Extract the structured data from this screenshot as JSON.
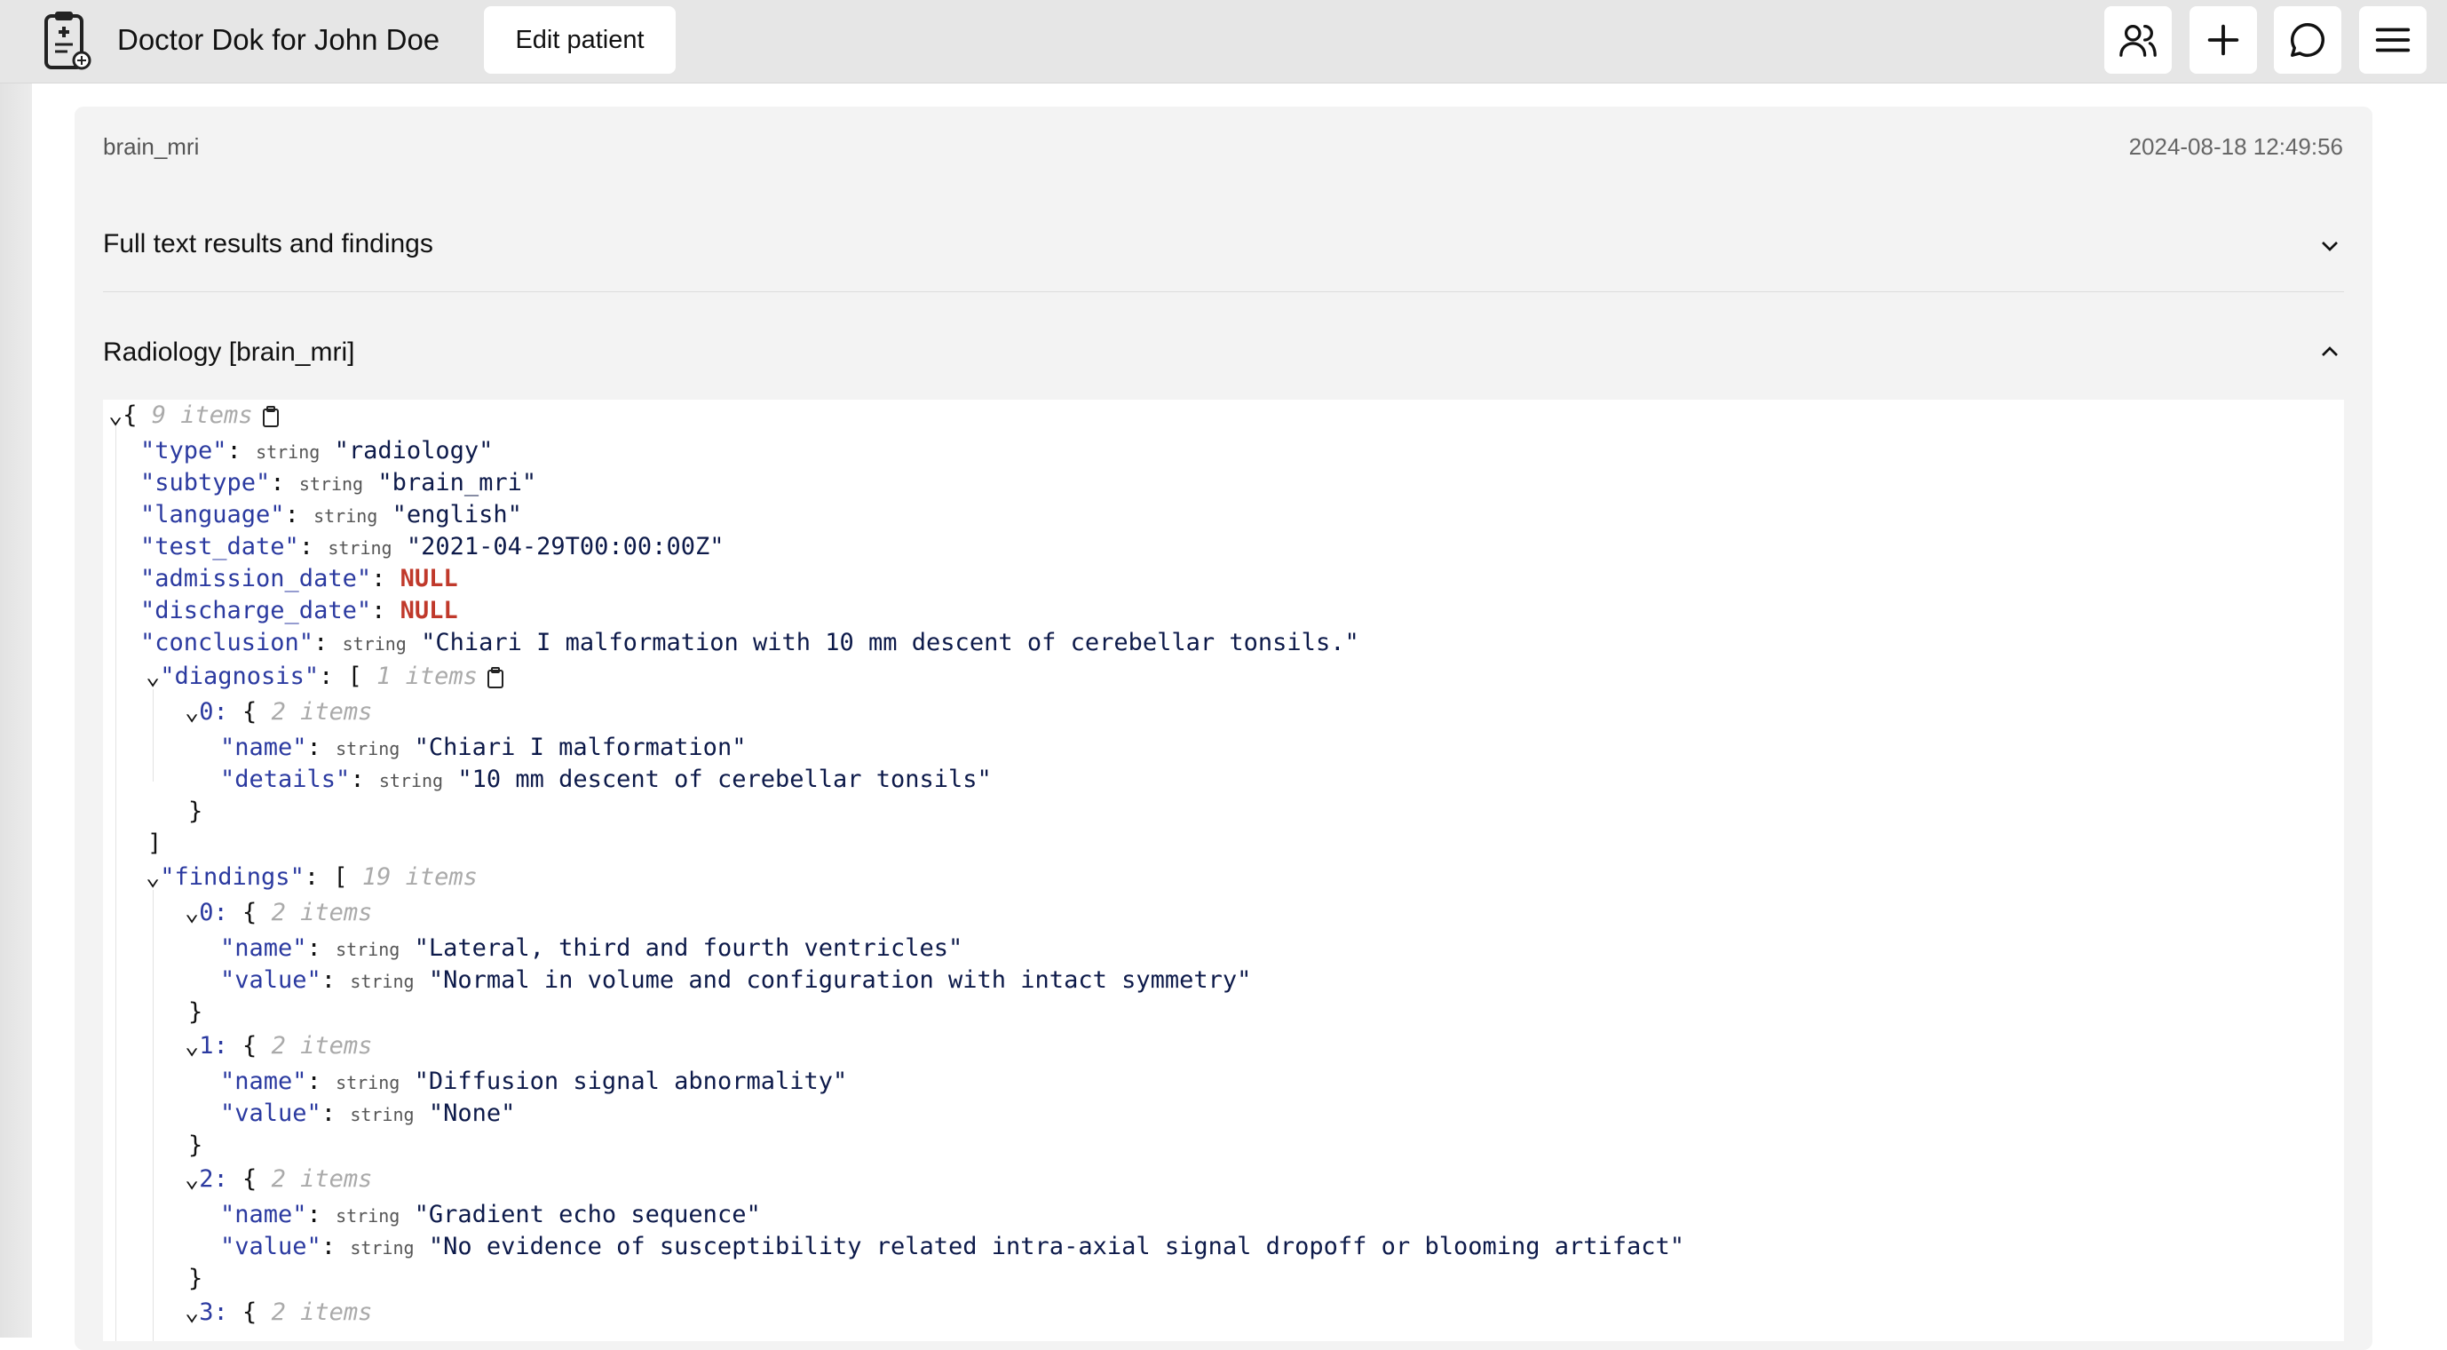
{
  "header": {
    "title": "Doctor Dok for John Doe",
    "edit_button": "Edit patient",
    "icons": [
      "users-icon",
      "plus-icon",
      "chat-icon",
      "menu-icon"
    ]
  },
  "record": {
    "file_name": "brain_mri",
    "date": "2024-08-18 12:49:56",
    "sections": {
      "full_text": "Full text results and findings",
      "radiology": "Radiology [brain_mri]"
    }
  },
  "json": {
    "root_count": "9 items",
    "type_key": "\"type\"",
    "type_val": "\"radiology\"",
    "subtype_key": "\"subtype\"",
    "subtype_val": "\"brain_mri\"",
    "language_key": "\"language\"",
    "language_val": "\"english\"",
    "test_date_key": "\"test_date\"",
    "test_date_val": "\"2021-04-29T00:00:00Z\"",
    "admission_key": "\"admission_date\"",
    "discharge_key": "\"discharge_date\"",
    "null_label": "NULL",
    "conclusion_key": "\"conclusion\"",
    "conclusion_val": "\"Chiari I malformation with 10 mm descent of cerebellar tonsils.\"",
    "diagnosis_key": "\"diagnosis\"",
    "diagnosis_count": "1 items",
    "diag0_name": "\"Chiari I malformation\"",
    "diag0_details": "\"10 mm descent of cerebellar tonsils\"",
    "findings_key": "\"findings\"",
    "findings_count": "19 items",
    "item_count": "2 items",
    "name_key": "\"name\"",
    "value_key": "\"value\"",
    "details_key": "\"details\"",
    "type_tag": "string",
    "f0_name": "\"Lateral, third and fourth ventricles\"",
    "f0_value": "\"Normal in volume and configuration with intact symmetry\"",
    "f1_name": "\"Diffusion signal abnormality\"",
    "f1_value": "\"None\"",
    "f2_name": "\"Gradient echo sequence\"",
    "f2_value": "\"No evidence of susceptibility related intra-axial signal dropoff or blooming artifact\"",
    "idx0": "0:",
    "idx1": "1:",
    "idx2": "2:",
    "idx3": "3:"
  }
}
